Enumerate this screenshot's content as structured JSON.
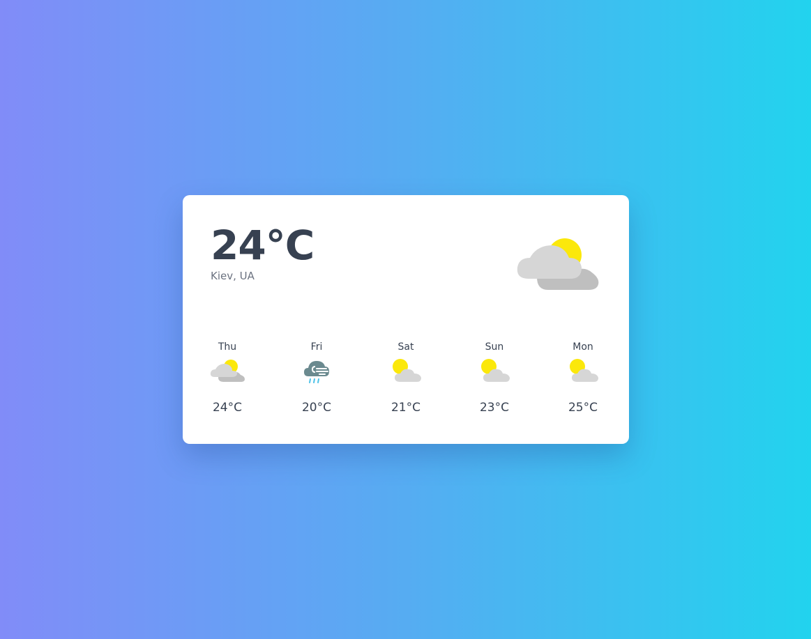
{
  "current": {
    "temperature": "24°C",
    "location": "Kiev, UA",
    "icon": "partly-cloudy-icon"
  },
  "forecast": [
    {
      "day": "Thu",
      "temp": "24°C",
      "icon": "cloudy-sun-icon"
    },
    {
      "day": "Fri",
      "temp": "20°C",
      "icon": "rain-wind-icon"
    },
    {
      "day": "Sat",
      "temp": "21°C",
      "icon": "sun-cloud-icon"
    },
    {
      "day": "Sun",
      "temp": "23°C",
      "icon": "sun-cloud-icon"
    },
    {
      "day": "Mon",
      "temp": "25°C",
      "icon": "sun-cloud-icon"
    }
  ],
  "colors": {
    "sun": "#fbe80b",
    "cloud_light": "#d6d6d6",
    "cloud_dark": "#bfbfbf",
    "rain_cloud": "#6b8a8f",
    "rain": "#4fc3e8"
  }
}
